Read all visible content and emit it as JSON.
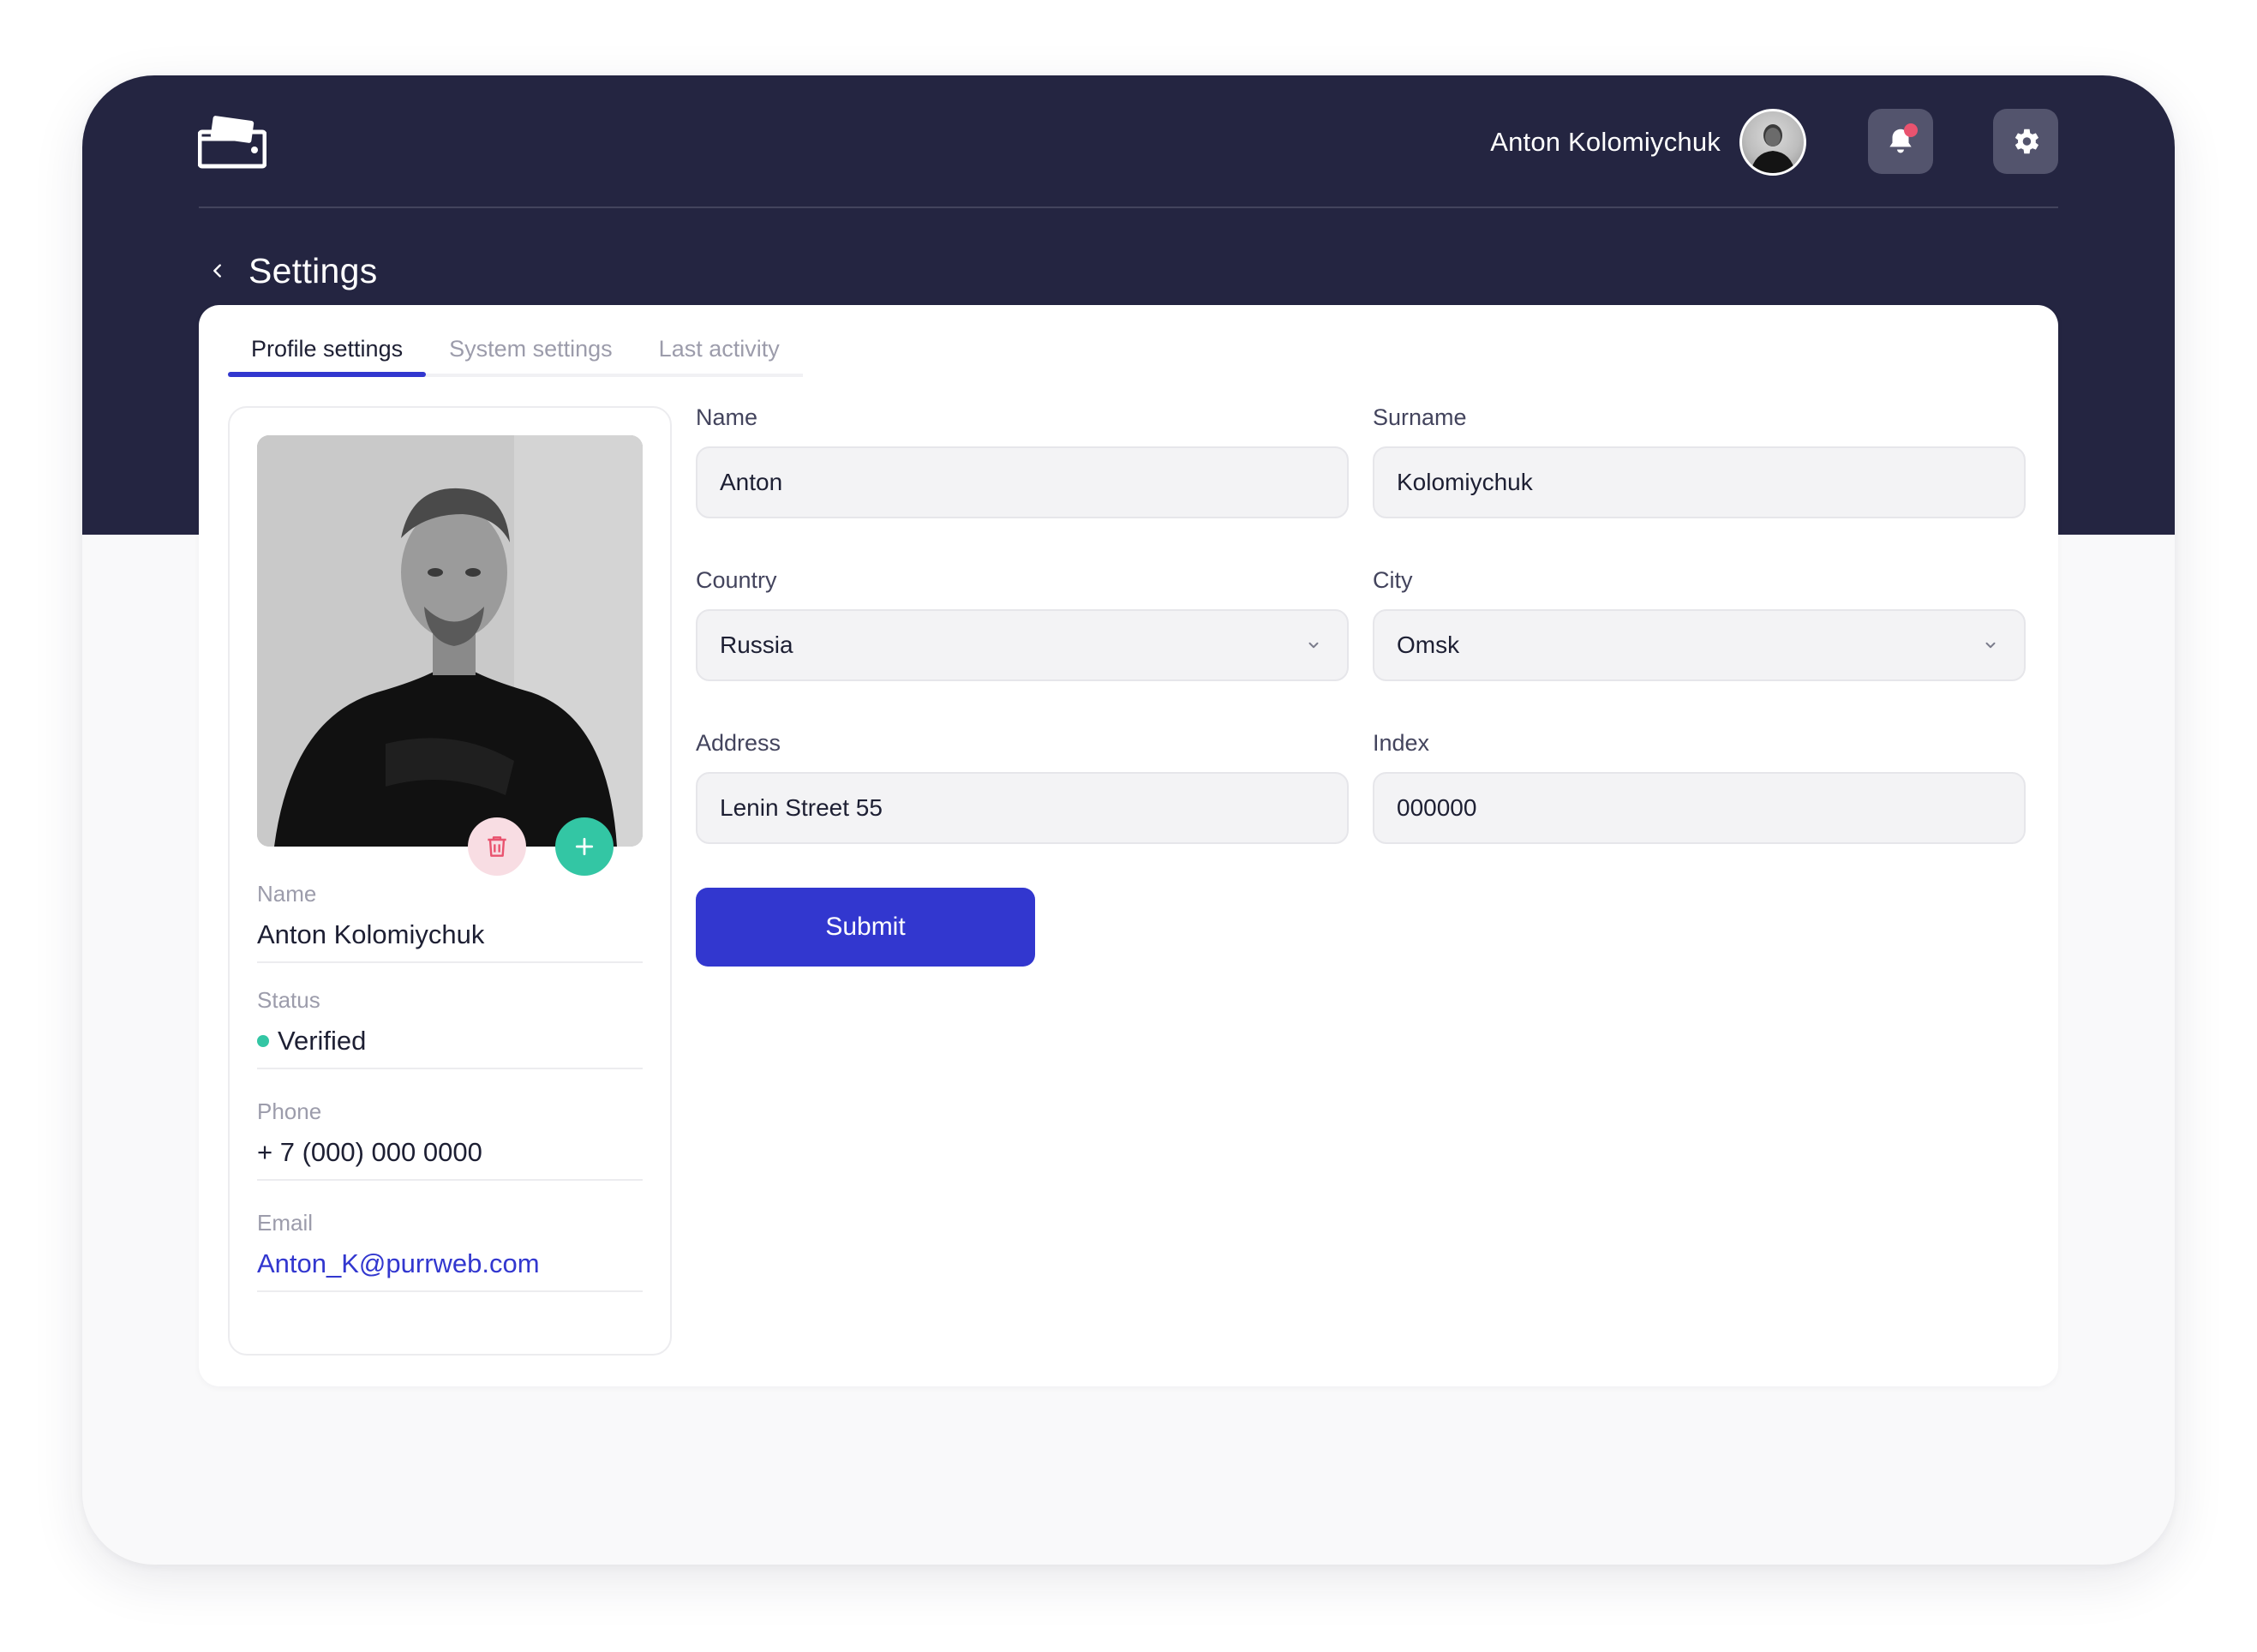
{
  "header": {
    "user_name": "Anton Kolomiychuk",
    "icons": {
      "logo": "wallet-logo",
      "avatar": "user-avatar",
      "notifications": "bell-icon",
      "settings": "gear-icon"
    },
    "notification_dot_color": "#e9536f"
  },
  "page": {
    "title": "Settings",
    "back_icon": "chevron-left-icon"
  },
  "tabs": [
    {
      "label": "Profile settings",
      "active": true
    },
    {
      "label": "System settings",
      "active": false
    },
    {
      "label": "Last activity",
      "active": false
    }
  ],
  "profile": {
    "photo_actions": {
      "delete_icon": "trash-icon",
      "add_icon": "plus-icon"
    },
    "name": {
      "label": "Name",
      "value": "Anton Kolomiychuk"
    },
    "status": {
      "label": "Status",
      "value": "Verified",
      "color": "#33c6a4"
    },
    "phone": {
      "label": "Phone",
      "value": "+ 7 (000) 000 0000"
    },
    "email": {
      "label": "Email",
      "value": "Anton_K@purrweb.com"
    }
  },
  "form": {
    "name": {
      "label": "Name",
      "value": "Anton"
    },
    "surname": {
      "label": "Surname",
      "value": "Kolomiychuk"
    },
    "country": {
      "label": "Country",
      "value": "Russia"
    },
    "city": {
      "label": "City",
      "value": "Omsk"
    },
    "address": {
      "label": "Address",
      "value": "Lenin Street 55"
    },
    "index": {
      "label": "Index",
      "value": "000000"
    },
    "submit_label": "Submit"
  },
  "colors": {
    "header_bg": "#242541",
    "accent": "#3237cf",
    "success": "#33c6a4",
    "danger_soft": "#f8dde3"
  }
}
